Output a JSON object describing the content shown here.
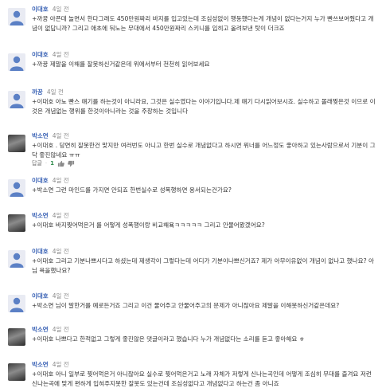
{
  "comments": [
    {
      "author": "이대호",
      "time": "4일 전",
      "avatar": "default-avatar-icon",
      "text": "+까꿍 아픈데 놀면서 한다그래도 450만원짜리 바지를 입고있는데 조심성없이 행동했다는게 개념이 없다는거지 누가 빤쓰보여줬다고 개념이 없답니까? 그리고 애초에 둬노는 무대에서 450만원짜리 스키니를 입히고 올려보낸 탓이 더크죠",
      "reply": "답글",
      "like_count": ""
    },
    {
      "author": "이대호",
      "time": "4일 전",
      "avatar": "default-avatar-icon",
      "text": "+까꿍 제말을 이해를 잘못하신거같은데 위에서부터 천천히 읽어보세요",
      "reply": "답글",
      "like_count": ""
    },
    {
      "author": "까꿍",
      "time": "4일 전",
      "avatar": "default-avatar-icon",
      "text": "+이대호 아뇨 빤스 얘기를 하는것이 아니라요, 그것은 실수였다는 이야기입니다.제 얘기 다시읽어보시죠. 실수하고 몰래찢은것 이므로 이것은 개념없는 행위를 한것이아니라는 것을 주장하는 것입니다",
      "reply": "답글",
      "like_count": ""
    },
    {
      "author": "박소연",
      "time": "4일 전",
      "avatar": "user-photo-avatar",
      "text": "+이대호 . 당연히 잘못한건 맞지만 여러번도 아니고 한번 실수로 개념없다고 하시면 위너를 어느정도 좋아하고 있는사람으로서 기분이 그닥 좋진않네요 ㅠㅠ",
      "reply": "답글",
      "like_count": "1"
    },
    {
      "author": "이대호",
      "time": "4일 전",
      "avatar": "default-avatar-icon",
      "text": "+박소연 그런 마인드를 가지면 안되죠 한번실수로 성폭행하면 용서되는건가요?",
      "reply": "답글",
      "like_count": ""
    },
    {
      "author": "박소연",
      "time": "4일 전",
      "avatar": "user-photo-avatar",
      "text": "+이대호 바지찢어먹은거 를 어떻게 성폭행이랑 비교해욬ㅋㅋㅋㅋㅋ 그리고 안물어봤겠어요?",
      "reply": "답글",
      "like_count": ""
    },
    {
      "author": "이대호",
      "time": "4일 전",
      "avatar": "default-avatar-icon",
      "text": "+이대호 그리고 기분나쁘시다고 하셨는데 제생각이 그렇다는데 어디가 기분이나쁘신거죠? 제가 아무이유없이 개념이 없나고 했나요? 아님 욕을했나요?",
      "reply": "답글",
      "like_count": ""
    },
    {
      "author": "이대호",
      "time": "4일 전",
      "avatar": "default-avatar-icon",
      "text": "+박소연 님이 말한거를 예로든거죠 그리고 이건 물어주고 안물어주고의 문제가 아니잖아요 제말을 이해못하신거같은데요?",
      "reply": "답글",
      "like_count": ""
    },
    {
      "author": "박소연",
      "time": "4일 전",
      "avatar": "user-photo-avatar",
      "text": "+이대호 나쁘다고 한적없고 그렇게 좋진않은 댓글이라고 했습니다 누가 개념없다는 소리를 듣고 좋아해요 ㅎ",
      "reply": "답글",
      "like_count": ""
    },
    {
      "author": "박소연",
      "time": "4일 전",
      "avatar": "user-photo-avatar",
      "text": "+이대호 아니 일부로 찢어먹은거 아니잖아요 실수로 찢어먹은거고 노래 자체가 저렇게 신나는곡인데 어떻게 조심히 무대를 즐겨요 저런 신나는곡에 맞게 편하게 입혀주지못한 잘못도 있는건데 조심성없다고 개념없다고 하는건 좀 아니죠",
      "reply": "답글",
      "like_count": ""
    }
  ]
}
